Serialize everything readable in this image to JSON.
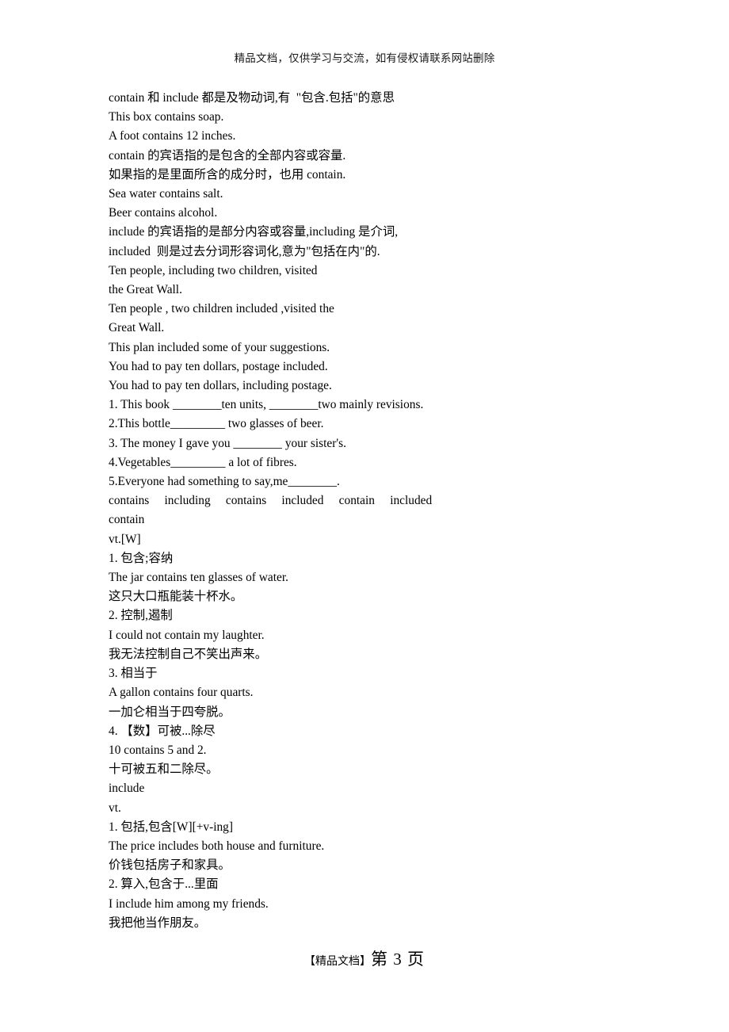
{
  "header": {
    "notice": "精品文档，仅供学习与交流，如有侵权请联系网站删除"
  },
  "document": {
    "lines": [
      "contain 和 include 都是及物动词,有  \"包含.包括\"的意思",
      "This box contains soap.",
      "A foot contains 12 inches.",
      "contain 的宾语指的是包含的全部内容或容量.",
      "如果指的是里面所含的成分时，也用 contain.",
      "Sea water contains salt.",
      "Beer contains alcohol.",
      "include 的宾语指的是部分内容或容量,including 是介词,",
      "included  则是过去分词形容词化,意为\"包括在内\"的.",
      "Ten people, including two children, visited",
      "the Great Wall.",
      "Ten people , two children included ,visited the",
      "Great Wall.",
      "This plan included some of your suggestions.",
      "You had to pay ten dollars, postage included.",
      "You had to pay ten dollars, including postage.",
      "1. This book ________ten units, ________two mainly revisions.",
      "2.This bottle_________ two glasses of beer.",
      "3. The money I gave you ________ your sister's.",
      "4.Vegetables_________ a lot of fibres.",
      "5.Everyone had something to say,me________.",
      "contains     including     contains     included     contain     included",
      "contain",
      "vt.[W]",
      "1. 包含;容纳",
      "The jar contains ten glasses of water.",
      "这只大口瓶能装十杯水。",
      "2. 控制,遏制",
      "I could not contain my laughter.",
      "我无法控制自己不笑出声来。",
      "3. 相当于",
      "A gallon contains four quarts.",
      "一加仑相当于四夸脱。",
      "4. 【数】可被...除尽",
      "10 contains 5 and 2.",
      "十可被五和二除尽。",
      "include",
      "vt.",
      "1. 包括,包含[W][+v-ing]",
      "The price includes both house and furniture.",
      "价钱包括房子和家具。",
      "2. 算入,包含于...里面",
      "I include him among my friends.",
      "我把他当作朋友。"
    ]
  },
  "footer": {
    "brand": "【精品文档】",
    "page_label": "第 3 页"
  }
}
